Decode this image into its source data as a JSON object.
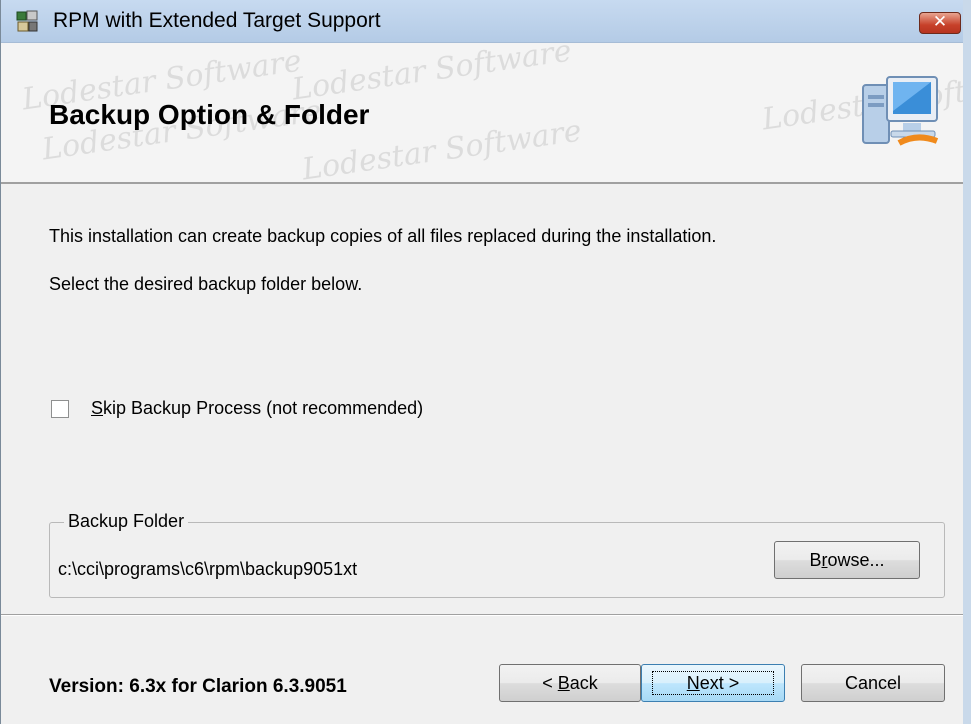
{
  "window": {
    "title": "RPM with Extended Target Support",
    "close_glyph": "✕"
  },
  "header": {
    "title": "Backup Option & Folder",
    "watermark_text": "Lodestar Software",
    "icon": "computer-icon"
  },
  "body": {
    "intro_line1": "This installation can create backup copies of all files replaced during the installation.",
    "intro_line2": "Select the desired backup folder below.",
    "skip_checkbox": {
      "label_mnemonic": "S",
      "label_rest": "kip Backup Process   (not recommended)",
      "checked": false
    },
    "backup_folder": {
      "legend": "Backup Folder",
      "path": "c:\\cci\\programs\\c6\\rpm\\backup9051xt",
      "browse_pre": "B",
      "browse_mnemonic": "r",
      "browse_post": "owse..."
    }
  },
  "footer": {
    "version": "Version: 6.3x for Clarion 6.3.9051",
    "back_pre": "< ",
    "back_mnemonic": "B",
    "back_post": "ack",
    "next_mnemonic": "N",
    "next_post": "ext >",
    "cancel_label": "Cancel"
  },
  "colors": {
    "titlebar": "#c7daf0",
    "close_button": "#c7412a",
    "dialog_background": "#f0f0f0",
    "default_button_border": "#3c7fb1"
  }
}
